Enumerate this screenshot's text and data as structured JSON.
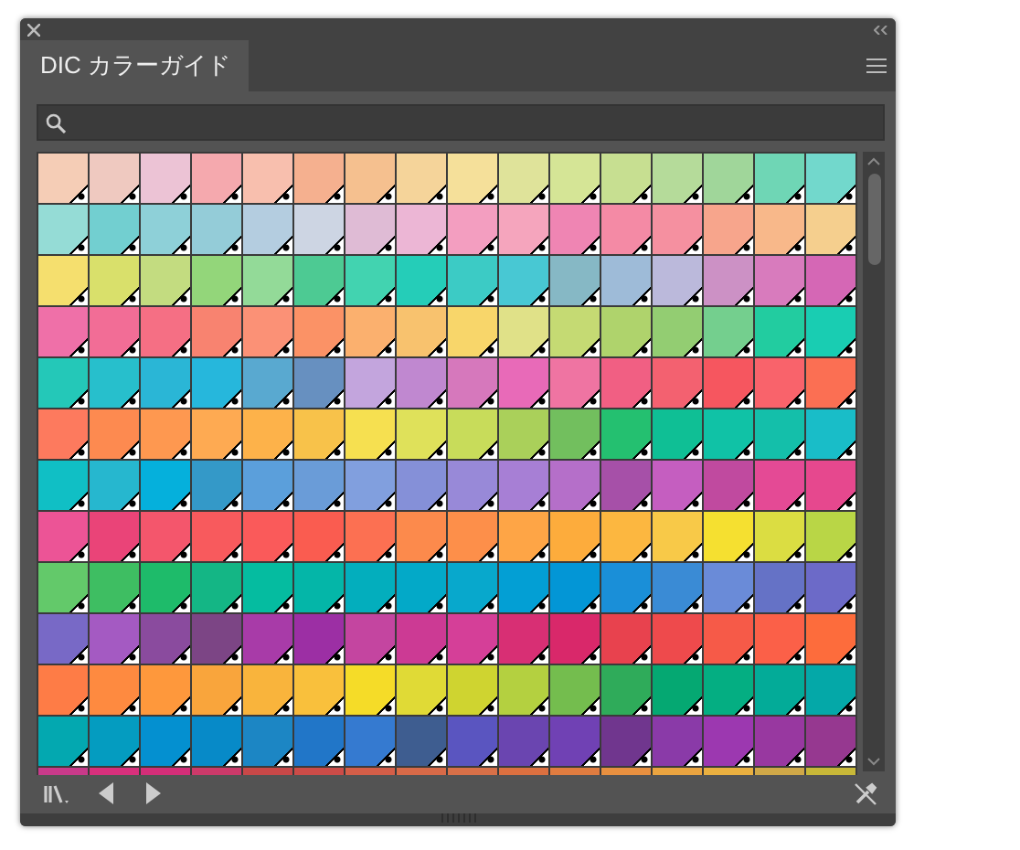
{
  "tabs": [
    {
      "label": "DIC カラーガイド",
      "selected": true
    }
  ],
  "swatches": [
    {
      "color": "#f5cdb6"
    },
    {
      "color": "#efc9c0"
    },
    {
      "color": "#ecc3d5"
    },
    {
      "color": "#f5a9ae"
    },
    {
      "color": "#f8bfae"
    },
    {
      "color": "#f5b08f"
    },
    {
      "color": "#f5c08f"
    },
    {
      "color": "#f5d49a"
    },
    {
      "color": "#f5e09a"
    },
    {
      "color": "#dfe39a"
    },
    {
      "color": "#d5e596"
    },
    {
      "color": "#c7df91"
    },
    {
      "color": "#b5db9a"
    },
    {
      "color": "#a0d69a"
    },
    {
      "color": "#6fd6b5"
    },
    {
      "color": "#72d8cc"
    },
    {
      "color": "#95dcd6"
    },
    {
      "color": "#72cfd0"
    },
    {
      "color": "#8ed0d8"
    },
    {
      "color": "#94ccd8"
    },
    {
      "color": "#b4cde0"
    },
    {
      "color": "#cdd5e3"
    },
    {
      "color": "#dfbbd5"
    },
    {
      "color": "#ecb6d5"
    },
    {
      "color": "#f39ec0"
    },
    {
      "color": "#f5a5bd"
    },
    {
      "color": "#ef85b3"
    },
    {
      "color": "#f48aa5"
    },
    {
      "color": "#f590a0"
    },
    {
      "color": "#f7a58c"
    },
    {
      "color": "#f8b88a"
    },
    {
      "color": "#f5cf8e"
    },
    {
      "color": "#f5df6e"
    },
    {
      "color": "#d9e06b"
    },
    {
      "color": "#c3dc80"
    },
    {
      "color": "#93d67a"
    },
    {
      "color": "#93da98"
    },
    {
      "color": "#4dca93"
    },
    {
      "color": "#42d3b0"
    },
    {
      "color": "#25cdb8"
    },
    {
      "color": "#3ccbc5"
    },
    {
      "color": "#48c8d3"
    },
    {
      "color": "#86b8c5"
    },
    {
      "color": "#9ebbd8"
    },
    {
      "color": "#bbb9db"
    },
    {
      "color": "#cc91c5"
    },
    {
      "color": "#d87bbd"
    },
    {
      "color": "#d567b5"
    },
    {
      "color": "#ef70a8"
    },
    {
      "color": "#f26d96"
    },
    {
      "color": "#f56f84"
    },
    {
      "color": "#f88370"
    },
    {
      "color": "#fb9176"
    },
    {
      "color": "#fb9266"
    },
    {
      "color": "#fbb06e"
    },
    {
      "color": "#f8c26e"
    },
    {
      "color": "#f8d66a"
    },
    {
      "color": "#e0e188"
    },
    {
      "color": "#c5da73"
    },
    {
      "color": "#afd36c"
    },
    {
      "color": "#93cd72"
    },
    {
      "color": "#74cf8e"
    },
    {
      "color": "#22cca0"
    },
    {
      "color": "#19cdb2"
    },
    {
      "color": "#24c8b8"
    },
    {
      "color": "#27bfcc"
    },
    {
      "color": "#2ab6d6"
    },
    {
      "color": "#26b7dc"
    },
    {
      "color": "#59a9d0"
    },
    {
      "color": "#6790c0"
    },
    {
      "color": "#c3a5dd"
    },
    {
      "color": "#c088d0"
    },
    {
      "color": "#d678bc"
    },
    {
      "color": "#e86ab8"
    },
    {
      "color": "#ef74a2"
    },
    {
      "color": "#f15f83"
    },
    {
      "color": "#f36170"
    },
    {
      "color": "#f6565f"
    },
    {
      "color": "#f9636b"
    },
    {
      "color": "#fb6f53"
    },
    {
      "color": "#fd7a5e"
    },
    {
      "color": "#fd8a50"
    },
    {
      "color": "#fe9850"
    },
    {
      "color": "#feaa52"
    },
    {
      "color": "#fdb24a"
    },
    {
      "color": "#f8c24a"
    },
    {
      "color": "#f6e050"
    },
    {
      "color": "#dfe15a"
    },
    {
      "color": "#c8dc5a"
    },
    {
      "color": "#aad05a"
    },
    {
      "color": "#72bf5e"
    },
    {
      "color": "#24c070"
    },
    {
      "color": "#0fbf95"
    },
    {
      "color": "#10c2a6"
    },
    {
      "color": "#14bfaa"
    },
    {
      "color": "#19bdc8"
    },
    {
      "color": "#10bfc5"
    },
    {
      "color": "#26b7cf"
    },
    {
      "color": "#05b0dc"
    },
    {
      "color": "#3499c8"
    },
    {
      "color": "#5b9fdb"
    },
    {
      "color": "#6a9cd8"
    },
    {
      "color": "#819fde"
    },
    {
      "color": "#8590d8"
    },
    {
      "color": "#9889d8"
    },
    {
      "color": "#a77fd5"
    },
    {
      "color": "#b56fc9"
    },
    {
      "color": "#a650a8"
    },
    {
      "color": "#c55ec0"
    },
    {
      "color": "#c04a9f"
    },
    {
      "color": "#e44a95"
    },
    {
      "color": "#e6488e"
    },
    {
      "color": "#ec5496"
    },
    {
      "color": "#ea4478"
    },
    {
      "color": "#f4566c"
    },
    {
      "color": "#f85a5d"
    },
    {
      "color": "#fa5a5a"
    },
    {
      "color": "#fa5c50"
    },
    {
      "color": "#fc7052"
    },
    {
      "color": "#fc8a4c"
    },
    {
      "color": "#fd8f4a"
    },
    {
      "color": "#fea546"
    },
    {
      "color": "#fdac3c"
    },
    {
      "color": "#fcb740"
    },
    {
      "color": "#f8c948"
    },
    {
      "color": "#f5e030"
    },
    {
      "color": "#dbdd42"
    },
    {
      "color": "#b9d646"
    },
    {
      "color": "#63c96a"
    },
    {
      "color": "#3ebe62"
    },
    {
      "color": "#1ebb6a"
    },
    {
      "color": "#14b685"
    },
    {
      "color": "#05bca0"
    },
    {
      "color": "#04b6a8"
    },
    {
      "color": "#03aebd"
    },
    {
      "color": "#03a9c8"
    },
    {
      "color": "#08a8cc"
    },
    {
      "color": "#039fd4"
    },
    {
      "color": "#0396d6"
    },
    {
      "color": "#1a8fd8"
    },
    {
      "color": "#3a8bd5"
    },
    {
      "color": "#6a8bd8"
    },
    {
      "color": "#6572c6"
    },
    {
      "color": "#6c6ac8"
    },
    {
      "color": "#7869c6"
    },
    {
      "color": "#a45ac2"
    },
    {
      "color": "#8a4b9e"
    },
    {
      "color": "#7c4585"
    },
    {
      "color": "#a83ba8"
    },
    {
      "color": "#9c2fa4"
    },
    {
      "color": "#c445a0"
    },
    {
      "color": "#cc3a94"
    },
    {
      "color": "#d53f98"
    },
    {
      "color": "#d82f74"
    },
    {
      "color": "#d9286a"
    },
    {
      "color": "#e8424e"
    },
    {
      "color": "#ee4a4c"
    },
    {
      "color": "#f65a48"
    },
    {
      "color": "#fb6048"
    },
    {
      "color": "#fd6c3c"
    },
    {
      "color": "#fe7c46"
    },
    {
      "color": "#fe8a40"
    },
    {
      "color": "#fe983c"
    },
    {
      "color": "#f9a53c"
    },
    {
      "color": "#f9b43c"
    },
    {
      "color": "#f9c03c"
    },
    {
      "color": "#f5dc28"
    },
    {
      "color": "#e0da36"
    },
    {
      "color": "#cfd430"
    },
    {
      "color": "#b4d040"
    },
    {
      "color": "#74bd4e"
    },
    {
      "color": "#2fab5a"
    },
    {
      "color": "#05a872"
    },
    {
      "color": "#04ae82"
    },
    {
      "color": "#03ab98"
    },
    {
      "color": "#04a8a8"
    },
    {
      "color": "#03a8b0"
    },
    {
      "color": "#049cc0"
    },
    {
      "color": "#0490d0"
    },
    {
      "color": "#078ac8"
    },
    {
      "color": "#1c86c4"
    },
    {
      "color": "#2176c8"
    },
    {
      "color": "#357ad0"
    },
    {
      "color": "#3e5d90"
    },
    {
      "color": "#5a55c0"
    },
    {
      "color": "#6a45b0"
    },
    {
      "color": "#7041b4"
    },
    {
      "color": "#70368e"
    },
    {
      "color": "#8a3aa8"
    },
    {
      "color": "#9c38b0"
    },
    {
      "color": "#9838a0"
    },
    {
      "color": "#963890"
    },
    {
      "color": "#c83a8a"
    },
    {
      "color": "#d8307c"
    },
    {
      "color": "#d42e78"
    },
    {
      "color": "#cc3a6a"
    },
    {
      "color": "#c84848"
    },
    {
      "color": "#cc4c48"
    },
    {
      "color": "#d45e48"
    },
    {
      "color": "#d86a48"
    },
    {
      "color": "#d87048"
    },
    {
      "color": "#dc7040"
    },
    {
      "color": "#e07c40"
    },
    {
      "color": "#e89040"
    },
    {
      "color": "#eaa440"
    },
    {
      "color": "#eab040"
    },
    {
      "color": "#d0a848"
    },
    {
      "color": "#c8b838"
    }
  ]
}
